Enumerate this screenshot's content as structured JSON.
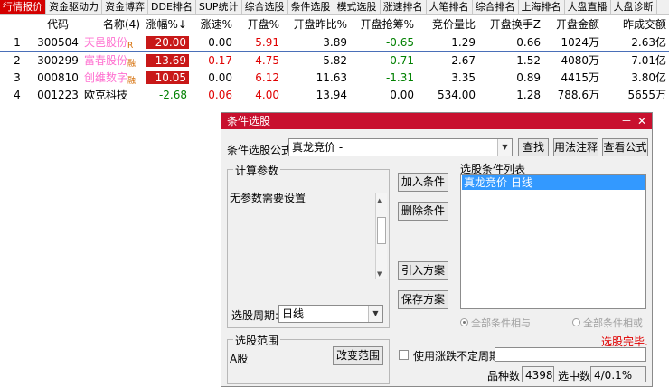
{
  "tabs": [
    "行情报价",
    "资金驱动力",
    "资金博弈",
    "DDE排名",
    "SUP统计",
    "综合选股",
    "条件选股",
    "模式选股",
    "涨速排名",
    "大笔排名",
    "综合排名",
    "上海排名",
    "大盘直播",
    "大盘诊断"
  ],
  "table": {
    "headers": [
      "",
      "代码",
      "名称(4)",
      "涨幅%↓",
      "涨速%",
      "开盘%",
      "开盘昨比%",
      "开盘抢筹%",
      "竞价量比",
      "开盘换手Z",
      "开盘金额",
      "昨成交额"
    ],
    "rows": [
      {
        "idx": "1",
        "code": "300504",
        "name": "天邑股份",
        "flag": "R",
        "pct": "20.00",
        "speed": "0.00",
        "open": "5.91",
        "openprev": "3.89",
        "grab": "-0.65",
        "ratio": "1.29",
        "turn": "0.66",
        "amount": "1024万",
        "prevamt": "2.63亿"
      },
      {
        "idx": "2",
        "code": "300299",
        "name": "富春股份",
        "flag": "融",
        "pct": "13.69",
        "speed": "0.17",
        "open": "4.75",
        "openprev": "5.82",
        "grab": "-0.71",
        "ratio": "2.67",
        "turn": "1.52",
        "amount": "4080万",
        "prevamt": "7.01亿"
      },
      {
        "idx": "3",
        "code": "000810",
        "name": "创维数字",
        "flag": "融",
        "pct": "10.05",
        "speed": "0.00",
        "open": "6.12",
        "openprev": "11.63",
        "grab": "-1.31",
        "ratio": "3.35",
        "turn": "0.89",
        "amount": "4415万",
        "prevamt": "3.80亿"
      },
      {
        "idx": "4",
        "code": "001223",
        "name": "欧克科技",
        "flag": "",
        "pct": "-2.68",
        "speed": "0.06",
        "open": "4.00",
        "openprev": "13.94",
        "grab": "0.00",
        "ratio": "534.00",
        "turn": "1.28",
        "amount": "788.6万",
        "prevamt": "5655万"
      }
    ]
  },
  "dialog": {
    "title": "条件选股",
    "min": "－",
    "close": "✕",
    "formula_label": "条件选股公式",
    "formula_value": "真龙竞价  -",
    "find": "查找",
    "usage": "用法注释",
    "view": "查看公式",
    "params_title": "计算参数",
    "params_text": "无参数需要设置",
    "add": "加入条件",
    "delete": "删除条件",
    "import": "引入方案",
    "save": "保存方案",
    "list_title": "选股条件列表",
    "list_item": "真龙竞价  日线",
    "period_label": "选股周期:",
    "period_value": "日线",
    "and_label": "全部条件相与",
    "or_label": "全部条件相或",
    "done": "选股完毕.",
    "scope_title": "选股范围",
    "scope_value": "A股",
    "change_scope": "改变范围",
    "use_period": "使用涨跌不定周期",
    "count_label": "品种数",
    "count_value": "4398",
    "selected_label": "选中数",
    "selected_value": "4/0.1%"
  },
  "colors": {
    "accent": "#c8102e",
    "up": "#e00000",
    "down": "#008000",
    "limit": "#ff70d0",
    "selection": "#3399ff"
  }
}
